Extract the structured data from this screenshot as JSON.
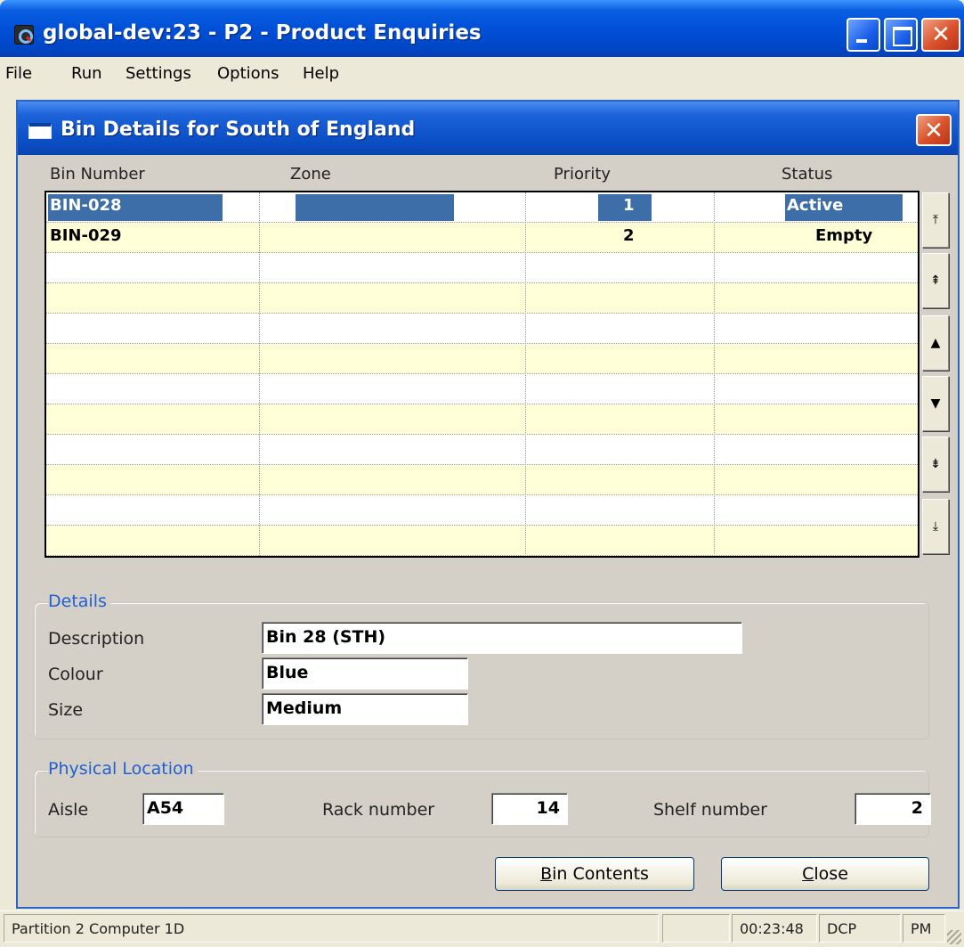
{
  "window": {
    "title": "global-dev:23 - P2 - Product Enquiries",
    "minimize_icon": "minimize-icon",
    "maximize_icon": "maximize-icon",
    "close_glyph": "✕"
  },
  "menu": {
    "file": "File",
    "run": "Run",
    "settings": "Settings",
    "options": "Options",
    "help": "Help"
  },
  "dialog": {
    "title": "Bin Details for South of England",
    "close_glyph": "✕"
  },
  "grid": {
    "headers": {
      "bin_number": "Bin Number",
      "zone": "Zone",
      "priority": "Priority",
      "status": "Status"
    },
    "rows": [
      {
        "bin_number": "BIN-028",
        "zone": "",
        "priority": "1",
        "status": "Active"
      },
      {
        "bin_number": "BIN-029",
        "zone": "",
        "priority": "2",
        "status": "Empty"
      }
    ],
    "selected_row_color": "#3d6ea8",
    "odd_row_color": "#ffffd8"
  },
  "scroll": {
    "top": "⤒",
    "page_up": "⇞",
    "up": "▲",
    "down": "▼",
    "page_down": "⇟",
    "bottom": "⤓"
  },
  "details": {
    "group_label": "Details",
    "description_label": "Description",
    "description_value": "Bin 28 (STH)",
    "colour_label": "Colour",
    "colour_value": "Blue",
    "size_label": "Size",
    "size_value": "Medium"
  },
  "location": {
    "group_label": "Physical Location",
    "aisle_label": "Aisle",
    "aisle_value": "A54",
    "rack_label": "Rack number",
    "rack_value": "14",
    "shelf_label": "Shelf number",
    "shelf_value": "2"
  },
  "buttons": {
    "bin_contents_u": "B",
    "bin_contents_rest": "in Contents",
    "close_u": "C",
    "close_rest": "lose"
  },
  "status": {
    "partition": "Partition 2 Computer 1D",
    "time": "00:23:48",
    "mode": "DCP",
    "period": "PM"
  }
}
